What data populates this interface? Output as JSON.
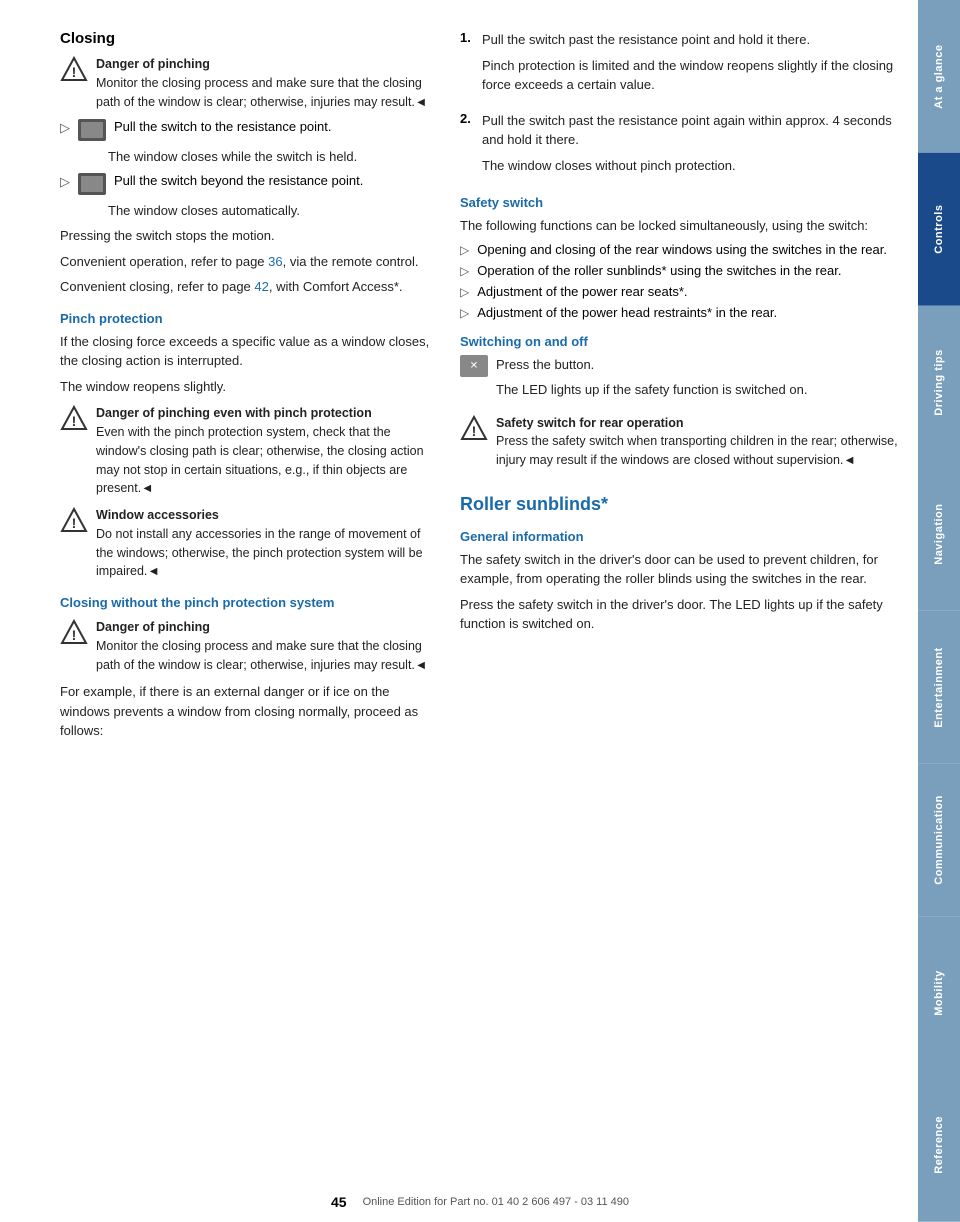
{
  "page": {
    "number": "45",
    "footer": "Online Edition for Part no. 01 40 2 606 497 - 03 11 490"
  },
  "sidebar": {
    "items": [
      {
        "label": "At a glance",
        "active": false
      },
      {
        "label": "Controls",
        "active": true
      },
      {
        "label": "Driving tips",
        "active": false
      },
      {
        "label": "Navigation",
        "active": false
      },
      {
        "label": "Entertainment",
        "active": false
      },
      {
        "label": "Communication",
        "active": false
      },
      {
        "label": "Mobility",
        "active": false
      },
      {
        "label": "Reference",
        "active": false
      }
    ]
  },
  "left": {
    "main_title": "Closing",
    "warning1": {
      "title": "Danger of pinching",
      "body": "Monitor the closing process and make sure that the closing path of the window is clear; otherwise, injuries may result.◄"
    },
    "step1_icon_label": "switch-icon",
    "step1_text": "Pull the switch to the resistance point.",
    "step1_sub": "The window closes while the switch is held.",
    "step2_text": "Pull the switch beyond the resistance point.",
    "step2_sub": "The window closes automatically.",
    "pressing_text": "Pressing the switch stops the motion.",
    "convenient1": "Convenient operation, refer to page ",
    "convenient1_link": "36",
    "convenient1_suffix": ", via the remote control.",
    "convenient2": "Convenient closing, refer to page ",
    "convenient2_link": "42",
    "convenient2_suffix": ", with Comfort Access*.",
    "pinch_title": "Pinch protection",
    "pinch_p1": "If the closing force exceeds a specific value as a window closes, the closing action is interrupted.",
    "pinch_p2": "The window reopens slightly.",
    "warning2": {
      "title": "Danger of pinching even with pinch protection",
      "body": "Even with the pinch protection system, check that the window's closing path is clear; otherwise, the closing action may not stop in certain situations, e.g., if thin objects are present.◄"
    },
    "warning3": {
      "title": "Window accessories",
      "body": "Do not install any accessories in the range of movement of the windows; otherwise, the pinch protection system will be impaired.◄"
    },
    "closing_no_pinch_title": "Closing without the pinch protection system",
    "warning4": {
      "title": "Danger of pinching",
      "body": "Monitor the closing process and make sure that the closing path of the window is clear; otherwise, injuries may result.◄"
    },
    "external_danger": "For example, if there is an external danger or if ice on the windows prevents a window from closing normally, proceed as follows:"
  },
  "right": {
    "step1_num": "1.",
    "step1_text1": "Pull the switch past the resistance point and hold it there.",
    "step1_text2": "Pinch protection is limited and the window reopens slightly if the closing force exceeds a certain value.",
    "step2_num": "2.",
    "step2_text1": "Pull the switch past the resistance point again within approx. 4 seconds and hold it there.",
    "step2_text2": "The window closes without pinch protection.",
    "safety_title": "Safety switch",
    "safety_p1": "The following functions can be locked simultaneously, using the switch:",
    "bullet1": "Opening and closing of the rear windows using the switches in the rear.",
    "bullet2": "Operation of the roller sunblinds* using the switches in the rear.",
    "bullet3": "Adjustment of the power rear seats*.",
    "bullet4": "Adjustment of the power head restraints* in the rear.",
    "switching_title": "Switching on and off",
    "switching_icon_label": "safety-switch-icon",
    "switching_p1": "Press the button.",
    "switching_p2": "The LED lights up if the safety function is switched on.",
    "warning5": {
      "title": "Safety switch for rear operation",
      "body": "Press the safety switch when transporting children in the rear; otherwise, injury may result if the windows are closed without supervision.◄"
    },
    "roller_title": "Roller sunblinds*",
    "general_title": "General information",
    "general_p1": "The safety switch in the driver's door can be used to prevent children, for example, from operating the roller blinds using the switches in the rear.",
    "general_p2": "Press the safety switch in the driver's door. The LED lights up if the safety function is switched on."
  }
}
